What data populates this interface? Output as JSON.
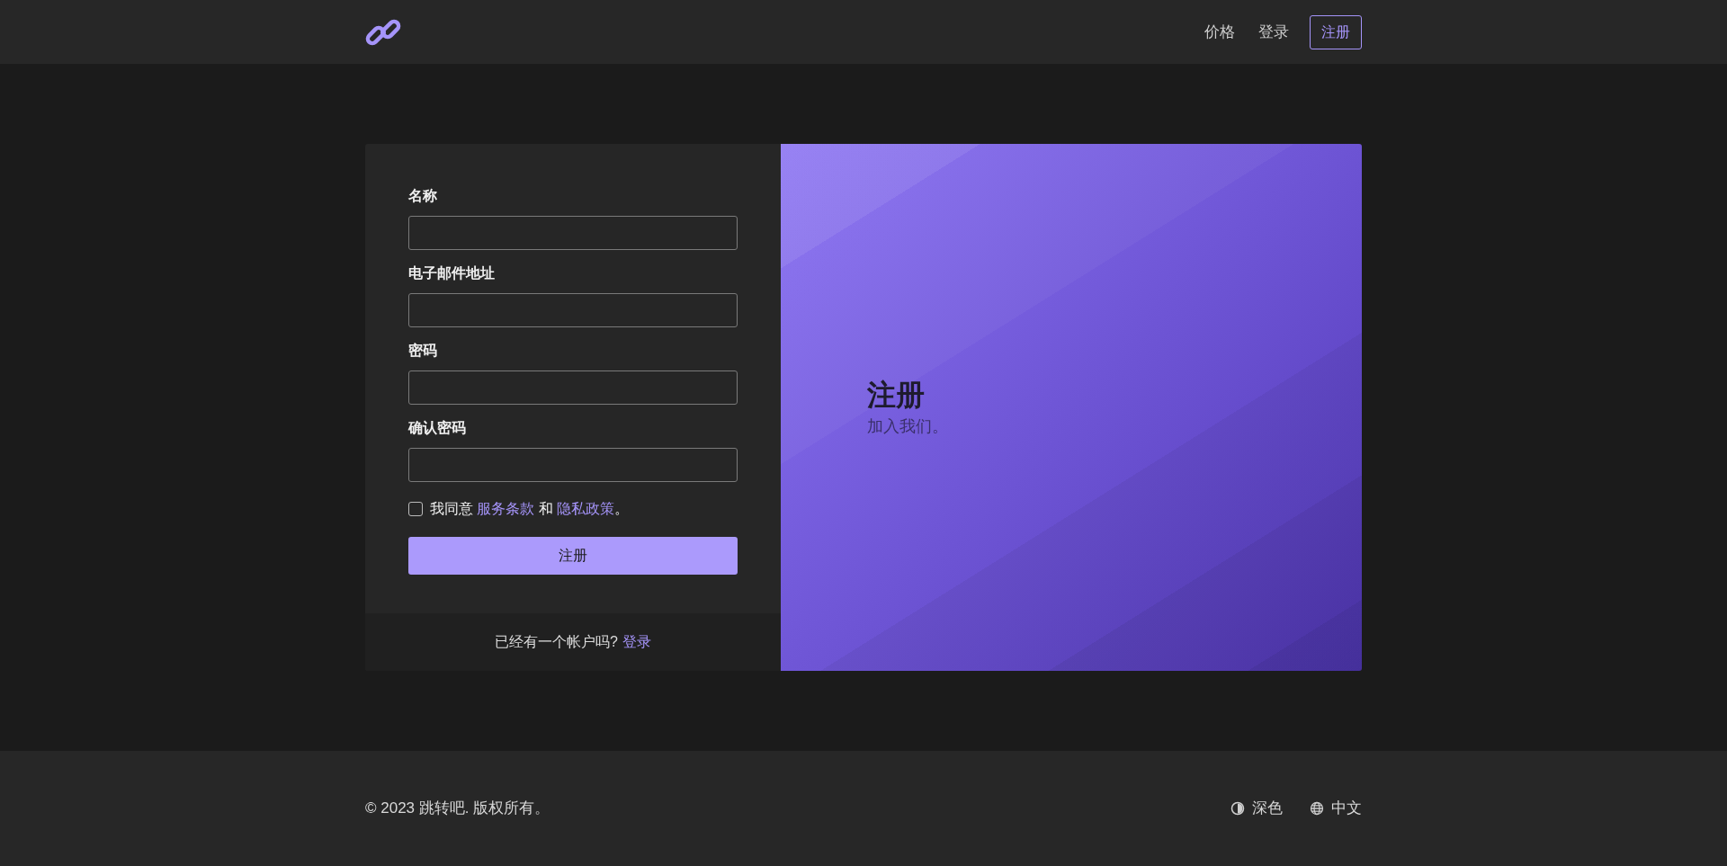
{
  "nav": {
    "links": [
      {
        "label": "价格"
      },
      {
        "label": "登录"
      }
    ],
    "signup_button": "注册"
  },
  "form": {
    "fields": [
      {
        "label": "名称"
      },
      {
        "label": "电子邮件地址"
      },
      {
        "label": "密码"
      },
      {
        "label": "确认密码"
      }
    ],
    "agree": {
      "checked": false,
      "parts": [
        {
          "kind": "text",
          "text": "我同意 "
        },
        {
          "kind": "link",
          "text": "服务条款"
        },
        {
          "kind": "text",
          "text": " 和 "
        },
        {
          "kind": "link",
          "text": "隐私政策"
        },
        {
          "kind": "text",
          "text": "。"
        }
      ]
    },
    "submit": "注册",
    "login_prompt": "已经有一个帐户吗?",
    "login_link": "登录"
  },
  "hero": {
    "title": "注册",
    "subtitle": "加入我们。"
  },
  "footer": {
    "copyright": "© 2023 跳转吧. 版权所有。",
    "theme": "深色",
    "language": "中文"
  }
}
